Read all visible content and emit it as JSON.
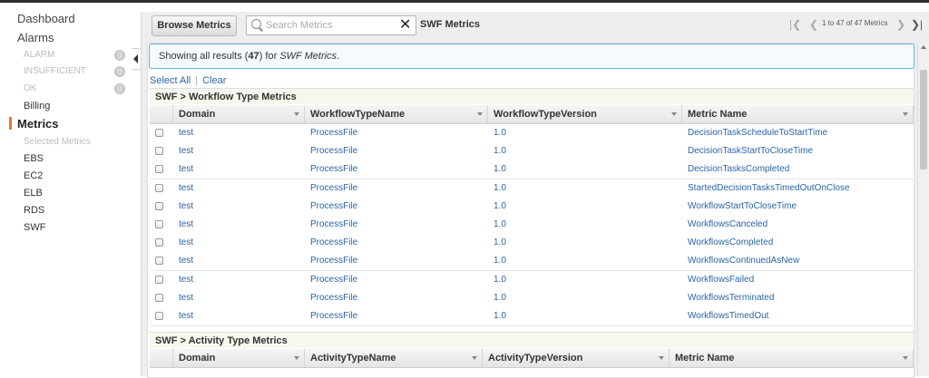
{
  "sidebar": {
    "dashboard": "Dashboard",
    "alarms": "Alarms",
    "alarm_states": [
      {
        "label": "ALARM",
        "count": "0"
      },
      {
        "label": "INSUFFICIENT",
        "count": "0"
      },
      {
        "label": "OK",
        "count": "0"
      }
    ],
    "billing": "Billing",
    "metrics": "Metrics",
    "selected_metrics": "Selected Metrics",
    "namespaces": [
      "EBS",
      "EC2",
      "ELB",
      "RDS",
      "SWF"
    ]
  },
  "toolbar": {
    "browse_label": "Browse Metrics",
    "search_placeholder": "Search Metrics",
    "search_value": "",
    "title": "SWF Metrics",
    "pager_text": "1 to 47 of 47 Metrics"
  },
  "info": {
    "prefix": "Showing all results (",
    "count": "47",
    "middle": ") for ",
    "namespace": "SWF Metrics",
    "suffix": "."
  },
  "select_all": "Select All",
  "clear": "Clear",
  "workflow_section": {
    "title": "SWF > Workflow Type Metrics",
    "columns": [
      "Domain",
      "WorkflowTypeName",
      "WorkflowTypeVersion",
      "Metric Name"
    ],
    "rows": [
      [
        "test",
        "ProcessFile",
        "1.0",
        "DecisionTaskScheduleToStartTime"
      ],
      [
        "test",
        "ProcessFile",
        "1.0",
        "DecisionTaskStartToCloseTime"
      ],
      [
        "test",
        "ProcessFile",
        "1.0",
        "DecisionTasksCompleted"
      ],
      [
        "test",
        "ProcessFile",
        "1.0",
        "StartedDecisionTasksTimedOutOnClose"
      ],
      [
        "test",
        "ProcessFile",
        "1.0",
        "WorkflowStartToCloseTime"
      ],
      [
        "test",
        "ProcessFile",
        "1.0",
        "WorkflowsCanceled"
      ],
      [
        "test",
        "ProcessFile",
        "1.0",
        "WorkflowsCompleted"
      ],
      [
        "test",
        "ProcessFile",
        "1.0",
        "WorkflowsContinuedAsNew"
      ],
      [
        "test",
        "ProcessFile",
        "1.0",
        "WorkflowsFailed"
      ],
      [
        "test",
        "ProcessFile",
        "1.0",
        "WorkflowsTerminated"
      ],
      [
        "test",
        "ProcessFile",
        "1.0",
        "WorkflowsTimedOut"
      ]
    ]
  },
  "activity_section": {
    "title": "SWF > Activity Type Metrics",
    "columns": [
      "Domain",
      "ActivityTypeName",
      "ActivityTypeVersion",
      "Metric Name"
    ]
  },
  "colors": {
    "link": "#2a64a9",
    "active_marker": "#e8781d",
    "info_border": "#6ab2d6"
  }
}
